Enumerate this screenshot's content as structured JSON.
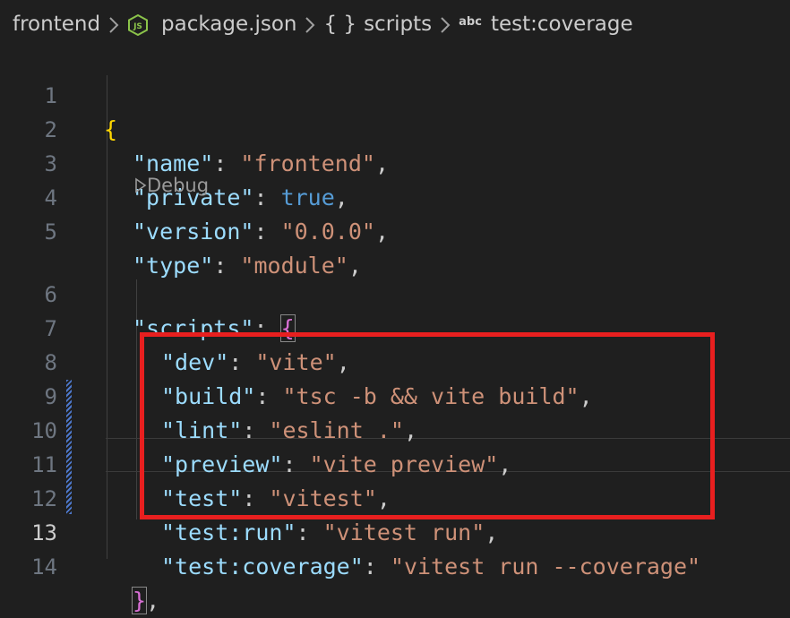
{
  "breadcrumb": {
    "folder": "frontend",
    "file_icon": "js-file-icon",
    "file": "package.json",
    "object_icon": "braces-icon",
    "object_icon_glyph": "{ }",
    "object": "scripts",
    "string_icon": "abc-string-icon",
    "string_icon_glyph": "abc",
    "string": "test:coverage"
  },
  "codelens": {
    "label": "Debug"
  },
  "lines": [
    {
      "n": "1",
      "open": "{"
    },
    {
      "n": "2",
      "key": "\"name\"",
      "colon": ": ",
      "value": "\"frontend\"",
      "end": ","
    },
    {
      "n": "3",
      "key": "\"private\"",
      "colon": ": ",
      "value": "true",
      "end": ","
    },
    {
      "n": "4",
      "key": "\"version\"",
      "colon": ": ",
      "value": "\"0.0.0\"",
      "end": ","
    },
    {
      "n": "5",
      "key": "\"type\"",
      "colon": ": ",
      "value": "\"module\"",
      "end": ","
    },
    {
      "n": "6",
      "key": "\"scripts\"",
      "colon": ": ",
      "open": "{"
    },
    {
      "n": "7",
      "key": "\"dev\"",
      "colon": ": ",
      "value": "\"vite\"",
      "end": ","
    },
    {
      "n": "8",
      "key": "\"build\"",
      "colon": ": ",
      "value": "\"tsc -b && vite build\"",
      "end": ","
    },
    {
      "n": "9",
      "key": "\"lint\"",
      "colon": ": ",
      "value": "\"eslint .\"",
      "end": ","
    },
    {
      "n": "10",
      "key": "\"preview\"",
      "colon": ": ",
      "value": "\"vite preview\"",
      "end": ","
    },
    {
      "n": "11",
      "key": "\"test\"",
      "colon": ": ",
      "value": "\"vitest\"",
      "end": ","
    },
    {
      "n": "12",
      "key": "\"test:run\"",
      "colon": ": ",
      "value": "\"vitest run\"",
      "end": ","
    },
    {
      "n": "13",
      "key": "\"test:coverage\"",
      "colon": ": ",
      "value": "\"vitest run --coverage\""
    },
    {
      "n": "14",
      "close": "}",
      "end": ","
    }
  ],
  "colors": {
    "background": "#1f1f1f",
    "key": "#9cdcfe",
    "string": "#ce9178",
    "boolean": "#569cd6",
    "brace_level1": "#ffd700",
    "brace_level2": "#da70d6",
    "highlight_box": "#e81f1f",
    "modified_gutter": "#4d78cc"
  }
}
